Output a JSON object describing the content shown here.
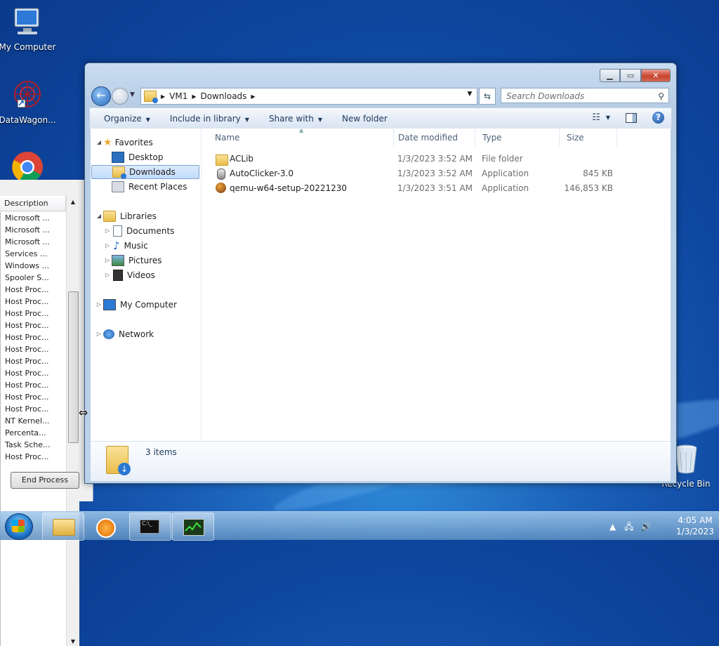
{
  "desktop": {
    "icons": [
      {
        "label": "My Computer"
      },
      {
        "label": "DataWagon..."
      },
      {
        "label": "Recycle Bin"
      }
    ]
  },
  "task_manager": {
    "column_header": "Description",
    "rows": [
      "Microsoft ...",
      "Microsoft ...",
      "Microsoft ...",
      "Services ...",
      "Windows ...",
      "Spooler S...",
      "Host Proc...",
      "Host Proc...",
      "Host Proc...",
      "Host Proc...",
      "Host Proc...",
      "Host Proc...",
      "Host Proc...",
      "Host Proc...",
      "Host Proc...",
      "Host Proc...",
      "Host Proc...",
      "NT Kernel...",
      "Percenta...",
      "Task Sche...",
      "Host Proc..."
    ],
    "end_process_label": "End Process"
  },
  "explorer": {
    "address": {
      "segments": [
        "VM1",
        "Downloads"
      ]
    },
    "search": {
      "placeholder": "Search Downloads"
    },
    "toolbar": {
      "organize": "Organize",
      "include_in_library": "Include in library",
      "share_with": "Share with",
      "new_folder": "New folder"
    },
    "nav": {
      "favorites": "Favorites",
      "desktop": "Desktop",
      "downloads": "Downloads",
      "recent_places": "Recent Places",
      "libraries": "Libraries",
      "documents": "Documents",
      "music": "Music",
      "pictures": "Pictures",
      "videos": "Videos",
      "my_computer": "My Computer",
      "network": "Network"
    },
    "columns": {
      "name": "Name",
      "date_modified": "Date modified",
      "type": "Type",
      "size": "Size"
    },
    "files": [
      {
        "name": "ACLib",
        "date": "1/3/2023 3:52 AM",
        "type": "File folder",
        "size": ""
      },
      {
        "name": "AutoClicker-3.0",
        "date": "1/3/2023 3:52 AM",
        "type": "Application",
        "size": "845 KB"
      },
      {
        "name": "qemu-w64-setup-20221230",
        "date": "1/3/2023 3:51 AM",
        "type": "Application",
        "size": "146,853 KB"
      }
    ],
    "status": {
      "items_count": "3 items"
    }
  },
  "taskbar": {
    "clock": {
      "time": "4:05 AM",
      "date": "1/3/2023"
    }
  }
}
